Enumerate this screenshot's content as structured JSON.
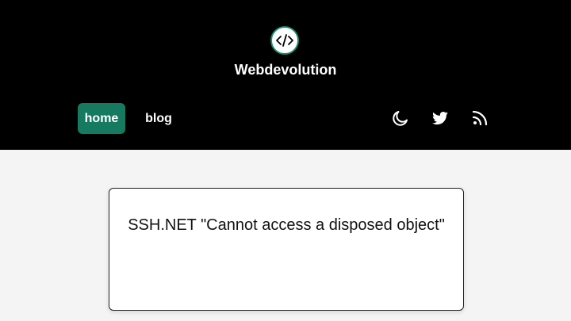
{
  "site": {
    "title": "Webdevolution",
    "logo_icon": "code-brackets-icon",
    "accent_color": "#157a60"
  },
  "nav": {
    "items": [
      {
        "label": "home",
        "active": true
      },
      {
        "label": "blog",
        "active": false
      }
    ],
    "icons": [
      "moon-icon",
      "twitter-icon",
      "rss-icon"
    ]
  },
  "posts": [
    {
      "title": "SSH.NET \"Cannot access a disposed object\""
    }
  ]
}
